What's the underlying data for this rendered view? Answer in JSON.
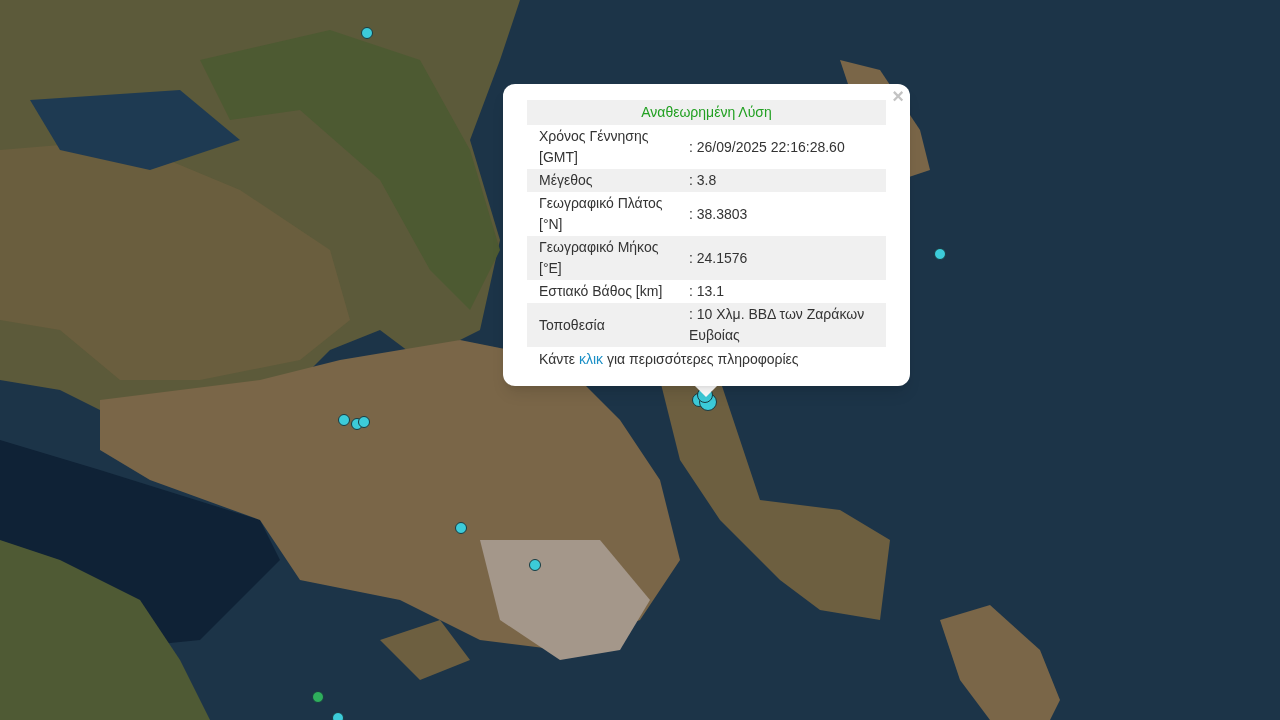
{
  "markers": [
    {
      "color": "#3ccbd9"
    },
    {
      "color": "#3ccbd9"
    },
    {
      "color": "#3ccbd9"
    },
    {
      "color": "#3ccbd9"
    },
    {
      "color": "#3ccbd9"
    },
    {
      "color": "#3ccbd9"
    },
    {
      "color": "#3ccbd9"
    },
    {
      "color": "#2eae5c"
    },
    {
      "color": "#3ccbd9"
    },
    {
      "color": "#3ccbd9"
    },
    {
      "color": "#3ccbd9"
    },
    {
      "color": "#3ccbd9"
    }
  ],
  "popup": {
    "close": "×",
    "title": "Αναθεωρημένη Λύση",
    "rows": [
      {
        "label": "Χρόνος Γέννησης [GMT]",
        "value": ": 26/09/2025 22:16:28.60"
      },
      {
        "label": "Μέγεθος",
        "value": ": 3.8"
      },
      {
        "label": "Γεωγραφικό Πλάτος [°N]",
        "value": ": 38.3803"
      },
      {
        "label": "Γεωγραφικό Μήκος [°E]",
        "value": ": 24.1576"
      },
      {
        "label": "Εστιακό Βάθος [km]",
        "value": ": 13.1"
      },
      {
        "label": "Τοποθεσία",
        "value": ": 10 Χλμ. ΒΒΔ των Ζαράκων Ευβοίας"
      }
    ],
    "footer": {
      "before": "Κάντε",
      "link": "κλικ",
      "after": "για περισσότερες πληροφορίες"
    }
  }
}
